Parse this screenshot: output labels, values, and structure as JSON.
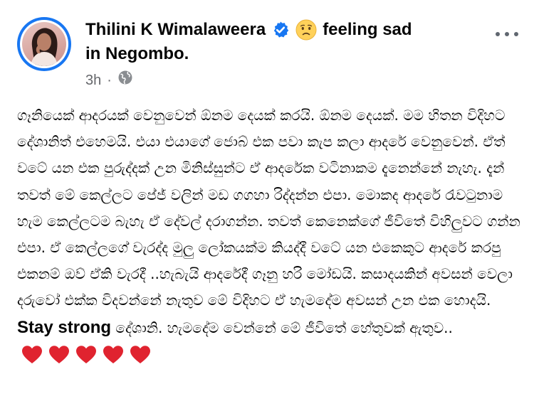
{
  "post": {
    "author_name": "Thilini K Wimalaweera",
    "feeling_text": "feeling sad",
    "location_prefix": "in",
    "location": "Negombo",
    "location_suffix": ".",
    "timestamp": "3h",
    "separator": "·",
    "audience_icon": "globe-icon",
    "verified_icon": "verified-badge-icon",
    "feeling_icon": "sad-face-emoji",
    "more_icon": "more-options-icon",
    "body_part1": "ගෑනියෙක් ආදරයක් වෙනුවෙන් ඕනම දෙයක් කරයි. ඕනම දෙයක්. මම හිතන විදිහට දේශානිත් එහෙමයි. එයා එයාගේ ජොබ් එක පවා කැප කලා ආදරේ වෙනුවෙන්. ඒත් වටේ යන එක පුරුද්දක් උන මිනිස්සුන්ට ඒ ආදරේක වටිනාකම දැනෙන්නේ නැහැ. දැන් තවත් මේ කෙල්ලට පේජ් වලින් මඩ ගගහා රිද්දන්න එපා. මොකද ආදරේ රැවටුනාම හැම කෙල්ලටම බැහැ ඒ දේවල් දරාගන්න. තවත් කෙනෙක්ගේ ජීවිතේ විහිලුවට ගන්න එපා. ඒ කෙල්ලගේ වැරද්ද මුලු ලෝකයක්ම කියද්දී වටේ යන එකෙකුට ආදරේ කරපු එකනම් ඔව් ඒකි වැරදී ..හැබැයි ආදරේදී ගෑනු හරි මෝඩයි. කසාදයකින් අවසන් වෙලා දරුවෝ එක්ක විදවන්නේ නැතුව මේ විදිහට ඒ හැමදේම අවසන්  උන එක හොදයි.",
    "body_strong": "Stay strong",
    "body_part2": "දේශානි. හැමදේම වෙන්නේ මේ ජීවිතේ හේතුවක් ඇතුව..",
    "heart_icons": [
      "heart-emoji",
      "heart-emoji",
      "heart-emoji",
      "heart-emoji",
      "heart-emoji"
    ],
    "colors": {
      "accent": "#1877f2",
      "meta_gray": "#65676b",
      "heart_red": "#e0232f"
    }
  }
}
